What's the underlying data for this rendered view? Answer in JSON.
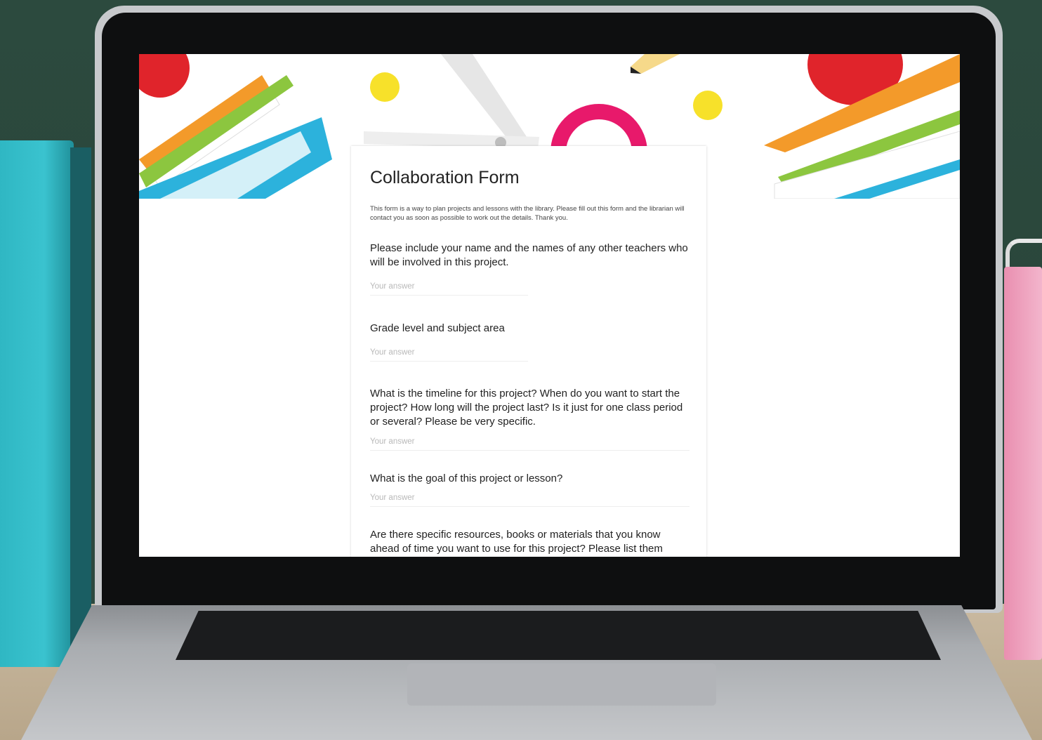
{
  "form": {
    "title": "Collaboration Form",
    "description": "This form is a way to plan projects and lessons with the library. Please fill out this form and the librarian will contact you as soon as possible to work out the details. Thank you.",
    "answer_placeholder": "Your answer",
    "questions": [
      {
        "label": "Please include your name and the names of any other teachers who will be involved in this project."
      },
      {
        "label": "Grade level and subject area"
      },
      {
        "label": "What is the timeline for this project? When do you want to start the project? How long will the project last? Is it just for one class period or several? Please be very specific."
      },
      {
        "label": "What is the goal of this project or lesson?"
      },
      {
        "label": "Are there specific resources, books or materials that you know ahead of time you want to use for this project? Please list them"
      }
    ]
  },
  "icons": {
    "banner": [
      "books-stack-icon",
      "apple-icon",
      "scissors-icon",
      "pencil-icon",
      "dot-icon"
    ]
  },
  "colors": {
    "apple": "#e0242b",
    "book_orange": "#f39a2a",
    "book_blue": "#2cb2dc",
    "book_green": "#8cc63f",
    "scissor_handle": "#e8196b",
    "dot_yellow": "#f7e12a"
  }
}
